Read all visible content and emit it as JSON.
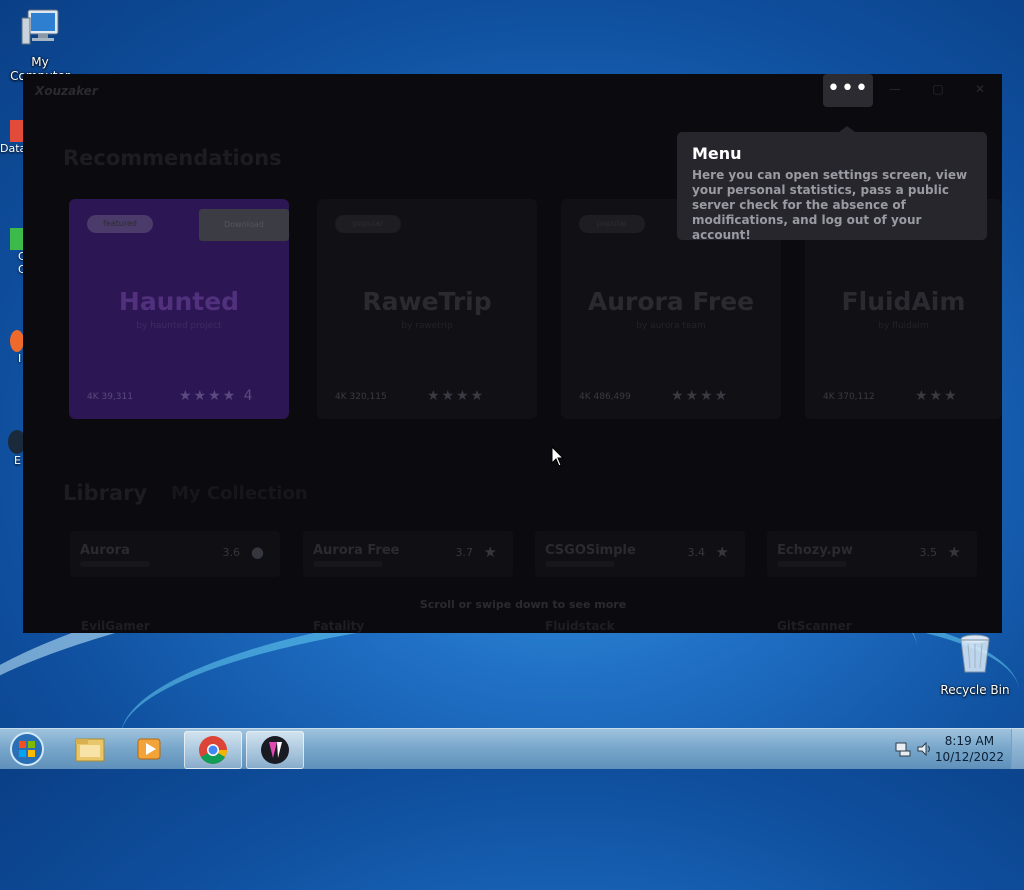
{
  "desktop": {
    "icons": [
      {
        "label": "My Computer",
        "icon": "computer-icon"
      },
      {
        "label": "Recycle Bin",
        "icon": "recycle-bin-icon"
      }
    ],
    "partial_labels": [
      "Data",
      "C",
      "C",
      "I",
      "E"
    ]
  },
  "app": {
    "title": "Xouzaker",
    "menu_label": "•••",
    "window_controls": [
      "—",
      "▢",
      "✕"
    ],
    "recommendations_title": "Recommendations",
    "cards": [
      {
        "name": "Haunted",
        "sub": "by haunted project",
        "pill": "featured",
        "tag": "Download",
        "downloads": "4K 39,311",
        "rating": "★★★★",
        "rating_val": "4",
        "featured": true
      },
      {
        "name": "RaweTrip",
        "sub": "by rawetrip",
        "pill": "popular",
        "tag": "",
        "downloads": "4K 320,115",
        "rating": "★★★★",
        "rating_val": "",
        "featured": false
      },
      {
        "name": "Aurora Free",
        "sub": "by aurora team",
        "pill": "popular",
        "tag": "",
        "downloads": "4K 486,499",
        "rating": "★★★★",
        "rating_val": "",
        "featured": false
      },
      {
        "name": "FluidAim",
        "sub": "by fluidaim",
        "pill": "",
        "tag": "",
        "downloads": "4K 370,112",
        "rating": "★★★",
        "rating_val": "",
        "featured": false
      }
    ],
    "library_title": "Library",
    "library_tab": "My Collection",
    "library_items": [
      {
        "name": "Aurora",
        "rating": "3.6",
        "icon": "tag-icon"
      },
      {
        "name": "Aurora Free",
        "rating": "3.7",
        "icon": "star-icon"
      },
      {
        "name": "CSGOSimple",
        "rating": "3.4",
        "icon": "star-icon"
      },
      {
        "name": "Echozy.pw",
        "rating": "3.5",
        "icon": "star-icon"
      }
    ],
    "scroll_hint": "Scroll or swipe down to see more",
    "next_row": [
      "EvilGamer",
      "Fatality",
      "Fluidstack",
      "GitScanner"
    ],
    "tooltip": {
      "title": "Menu",
      "text": "Here you can open settings screen, view your personal statistics, pass a public server check for the absence of modifications, and log out of your account!"
    }
  },
  "taskbar": {
    "buttons": [
      {
        "name": "explorer",
        "icon": "folder-icon",
        "active": false
      },
      {
        "name": "media-player",
        "icon": "media-player-icon",
        "active": false
      },
      {
        "name": "chrome",
        "icon": "chrome-icon",
        "active": true
      },
      {
        "name": "app",
        "icon": "app-icon",
        "active": true
      }
    ],
    "time": "8:19 AM",
    "date": "10/12/2022"
  },
  "colors": {
    "tooltip_bg": "#26262c",
    "window_bg": "#0b0b0f",
    "featured_card": "#2c1653"
  }
}
